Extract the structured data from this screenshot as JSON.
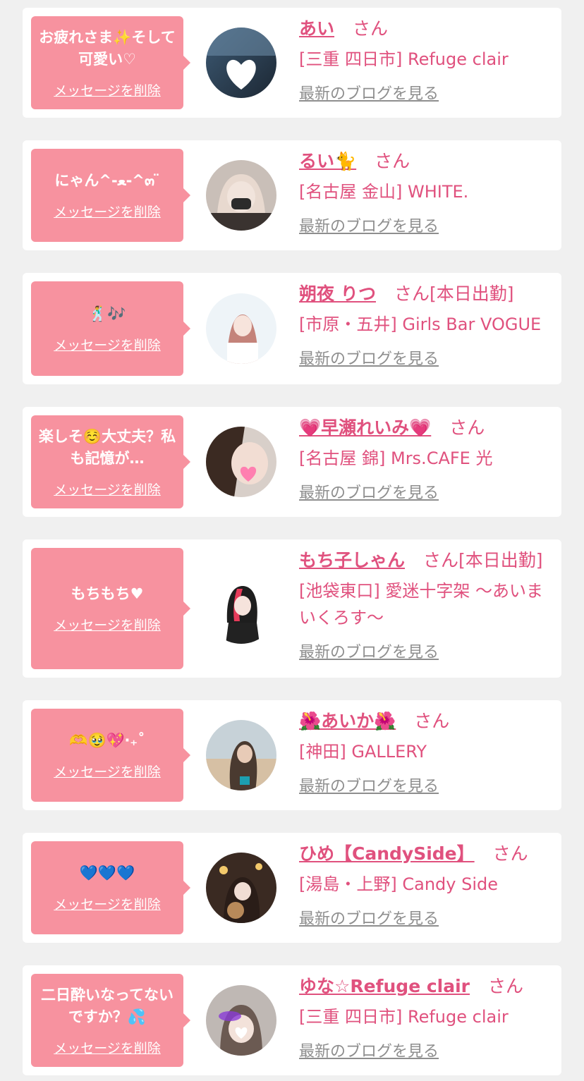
{
  "entries": [
    {
      "message": "お疲れさま✨そして可愛い♡",
      "delete_label": "メッセージを削除",
      "name": "あい",
      "san": "さん",
      "status": "",
      "shop": "[三重 四日市] Refuge clair",
      "blog_label": "最新のブログを見る"
    },
    {
      "message": "にゃん^-ﻌ-^๓ ̈",
      "delete_label": "メッセージを削除",
      "name": "るい🐈",
      "san": "さん",
      "status": "",
      "shop": "[名古屋 金山] WHITE.",
      "blog_label": "最新のブログを見る"
    },
    {
      "message": "🕺🎶",
      "delete_label": "メッセージを削除",
      "name": "朔夜 りつ",
      "san": "さん",
      "status": "[本日出勤]",
      "shop": "[市原・五井] Girls Bar VOGUE",
      "blog_label": "最新のブログを見る"
    },
    {
      "message": "楽しそ☺️大丈夫？私も記憶が…",
      "delete_label": "メッセージを削除",
      "name": "💗早瀬れいみ💗",
      "san": "さん",
      "status": "",
      "shop": "[名古屋 錦] Mrs.CAFE 光",
      "blog_label": "最新のブログを見る"
    },
    {
      "message": "もちもち♥",
      "delete_label": "メッセージを削除",
      "name": "もち子しゃん",
      "san": "さん",
      "status": "[本日出勤]",
      "shop": "[池袋東口] 愛迷十字架 〜あいまいくろす〜",
      "blog_label": "最新のブログを見る"
    },
    {
      "message": "🫶🥹💖‧₊˚",
      "delete_label": "メッセージを削除",
      "name": "🌺あいか🌺",
      "san": "さん",
      "status": "",
      "shop": "[神田] GALLERY",
      "blog_label": "最新のブログを見る"
    },
    {
      "message": "💙💙💙",
      "delete_label": "メッセージを削除",
      "name": "ひめ【CandySide】",
      "san": "さん",
      "status": "",
      "shop": "[湯島・上野] Candy Side",
      "blog_label": "最新のブログを見る"
    },
    {
      "message": "二日酔いなってないですか？💦",
      "delete_label": "メッセージを削除",
      "name": "ゆな☆Refuge clair",
      "san": "さん",
      "status": "",
      "shop": "[三重 四日市] Refuge clair",
      "blog_label": "最新のブログを見る"
    }
  ],
  "colors": {
    "page_bg": "#f0f0f0",
    "card_bg": "#ffffff",
    "bubble": "#f7929f",
    "name_pink": "#e0517e",
    "link_gray": "#8e8e8e"
  }
}
